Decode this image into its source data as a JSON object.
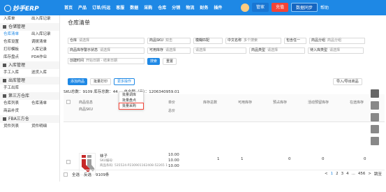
{
  "topbar": {
    "logo": "妙手ERP",
    "nav": [
      "首页",
      "产品",
      "订单/托运",
      "客服",
      "数据",
      "采购",
      "仓库",
      "分销",
      "物流",
      "财务",
      "插件"
    ],
    "new_badge": "NEW",
    "user_badge": "管家",
    "recharge": "充值",
    "sync": "数据同步",
    "help": "帮助"
  },
  "sidebar": {
    "top_row": [
      "入库单",
      "出入库记录"
    ],
    "groups": [
      {
        "label": "仓储管理",
        "rows": [
          [
            "仓库清单",
            "出入库记录"
          ],
          [
            "仓库设置",
            "调拨清单"
          ],
          [
            "打印模板",
            "入库记录"
          ],
          [
            "库存盘点",
            "PDA作业"
          ]
        ]
      },
      {
        "label": "入库管理",
        "rows": [
          [
            "手工入库",
            "送货入库"
          ]
        ]
      },
      {
        "label": "出库管理",
        "rows": [
          [
            "手工出库",
            ""
          ]
        ]
      },
      {
        "label": "第三方仓库",
        "rows": [
          [
            "仓库列表",
            "仓库清单"
          ],
          [
            "商品补货",
            ""
          ]
        ]
      },
      {
        "label": "FBA三方仓",
        "rows": [
          [
            "货件列表",
            "货件明细"
          ]
        ]
      }
    ]
  },
  "page": {
    "title": "仓库清单",
    "filters": {
      "row1": [
        {
          "label": "仓库",
          "value": "请选择"
        },
        {
          "label": "商品SKU",
          "value": "双击"
        },
        {
          "label": "模糊匹配",
          "value": ""
        },
        {
          "label": "中文名称",
          "value": "多个搜索"
        },
        {
          "label": "包含任一",
          "value": ""
        },
        {
          "label": "商品分组",
          "value": "商品分组"
        }
      ],
      "row2": [
        {
          "label": "商品库存警示状态",
          "value": "请选择"
        },
        {
          "label": "可用库存",
          "value": "请选择"
        },
        {
          "label": "",
          "value": "请选择"
        },
        {
          "label": "商品类型",
          "value": "请选择"
        },
        {
          "label": "待入库类型",
          "value": "请选择"
        }
      ],
      "row3": [
        {
          "label": "创建时间",
          "value": "开始日期 - 结束日期"
        }
      ],
      "search": "搜索",
      "reset": "重置"
    },
    "actions": {
      "add": "添加商品",
      "batch_print": "批量打印",
      "more": "更多操作",
      "import_export": "导入/导出商品"
    },
    "menu": [
      "批量调库",
      "批量盘点",
      "批量采购"
    ],
    "summary": "SKU总数：9109  库存总数：44 ...  总金额（元）：1206340959.01",
    "table": {
      "headers": [
        "商品信息",
        "商品SKU",
        "单价",
        "总价",
        "库存总数",
        "可用库存",
        "预占库存",
        "活动预留库存",
        "在途库存"
      ],
      "rows": [
        {
          "name": "袜子",
          "sku": "SKU编号:",
          "barcode": "商品条码: 535524-P230901162408-52265 1",
          "unit_price": "10.00",
          "price2": "10.00",
          "total_price": "10.00",
          "stock_total": "1",
          "available": "1",
          "reserved": "0",
          "activity": "0",
          "transit": "0"
        }
      ]
    },
    "footer": {
      "select_all": "全选",
      "invert": "反选",
      "count": "9109条"
    },
    "pager": [
      "<",
      "1",
      "2",
      "3",
      "4",
      "...",
      "456",
      ">",
      "跳至"
    ]
  }
}
